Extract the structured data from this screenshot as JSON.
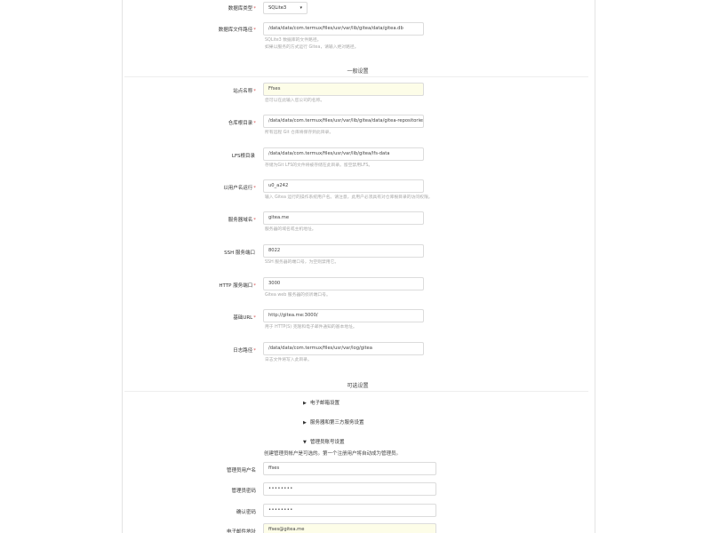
{
  "database": {
    "type_label": "数据库类型",
    "type_value": "SQLite3",
    "path_label": "数据库文件路径",
    "path_value": "/data/data/com.termux/files/usr/var/lib/gitea/data/gitea.db",
    "path_help_1": "SQLite3 数据库的文件路径。",
    "path_help_2": "如果以服务的方式运行 Gitea，请输入绝对路径。"
  },
  "general": {
    "section_title": "一般设置",
    "fields": [
      {
        "label": "站点名称",
        "required": "*",
        "value": "Ffses",
        "help": "您可以在此输入您公司的名称。"
      },
      {
        "label": "仓库根目录",
        "required": "*",
        "value": "/data/data/com.termux/files/usr/var/lib/gitea/data/gitea-repositories",
        "help": "所有远程 Git 仓库将保存到此目录。"
      },
      {
        "label": "LFS根目录",
        "required": "",
        "value": "/data/data/com.termux/files/usr/var/lib/gitea/lfs-data",
        "help": "存储为Git LFS的文件将被存储在此目录。留空禁用LFS。"
      },
      {
        "label": "以用户名运行",
        "required": "*",
        "value": "u0_a242",
        "help": "输入 Gitea 运行的操作系统用户名。请注意，此用户必须具有对仓库根目录的访问权限。"
      },
      {
        "label": "服务器域名",
        "required": "*",
        "value": "gitea.me",
        "help": "服务器的域名或主机地址。"
      },
      {
        "label": "SSH 服务端口",
        "required": "",
        "value": "8022",
        "help": "SSH 服务器的端口号，为空则禁用它。"
      },
      {
        "label": "HTTP 服务端口",
        "required": "*",
        "value": "3000",
        "help": "Gitea web 服务器的侦听端口号。"
      },
      {
        "label": "基础URL",
        "required": "*",
        "value": "http://gitea.me:3000/",
        "help": "用于 HTTP(S) 克隆和电子邮件通知的基本地址。"
      },
      {
        "label": "日志路径",
        "required": "*",
        "value": "/data/data/com.termux/files/usr/var/log/gitea",
        "help": "日志文件将写入此目录。"
      }
    ]
  },
  "optional": {
    "section_title": "可选设置",
    "toggles": [
      "电子邮箱设置",
      "服务器和第三方服务设置",
      "管理员账号设置"
    ],
    "admin_note": "创建管理员帐户是可选的。第一个注册用户将自动成为管理员。",
    "admin_fields": [
      {
        "label": "管理员用户名",
        "value": "ffses"
      },
      {
        "label": "管理员密码",
        "value": "••••••••"
      },
      {
        "label": "确认密码",
        "value": "••••••••"
      },
      {
        "label": "电子邮件地址",
        "value": "ffses@gitea.me"
      }
    ]
  }
}
